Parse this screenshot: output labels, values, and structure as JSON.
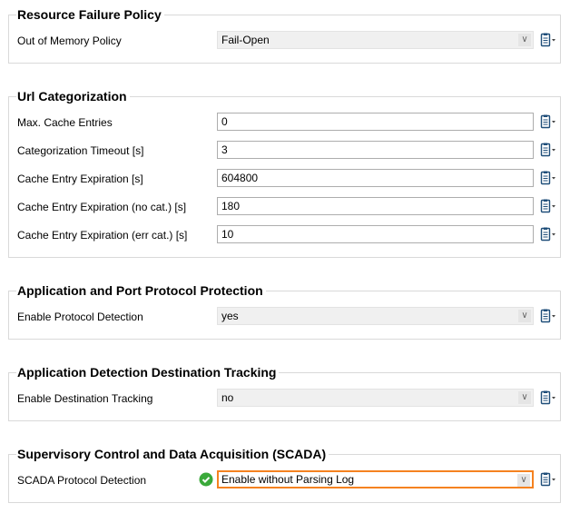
{
  "sections": [
    {
      "title": "Resource Failure Policy",
      "rows": [
        {
          "label": "Out of Memory Policy",
          "type": "select",
          "value": "Fail-Open"
        }
      ]
    },
    {
      "title": "Url Categorization",
      "rows": [
        {
          "label": "Max. Cache Entries",
          "type": "input",
          "value": "0"
        },
        {
          "label": "Categorization Timeout [s]",
          "type": "input",
          "value": "3"
        },
        {
          "label": "Cache Entry Expiration [s]",
          "type": "input",
          "value": "604800"
        },
        {
          "label": "Cache Entry Expiration (no cat.) [s]",
          "type": "input",
          "value": "180"
        },
        {
          "label": "Cache Entry Expiration (err cat.) [s]",
          "type": "input",
          "value": "10"
        }
      ]
    },
    {
      "title": "Application and Port Protocol Protection",
      "rows": [
        {
          "label": "Enable Protocol Detection",
          "type": "select",
          "value": "yes"
        }
      ]
    },
    {
      "title": "Application Detection Destination Tracking",
      "rows": [
        {
          "label": "Enable Destination Tracking",
          "type": "select",
          "value": "no"
        }
      ]
    },
    {
      "title": "Supervisory Control and Data Acquisition (SCADA)",
      "rows": [
        {
          "label": "SCADA Protocol Detection",
          "type": "select",
          "value": "Enable without Parsing Log",
          "active": true,
          "status_icon": "check-circle-icon"
        }
      ]
    }
  ],
  "colors": {
    "focus": "#f58220",
    "ok": "#3aa93a"
  }
}
